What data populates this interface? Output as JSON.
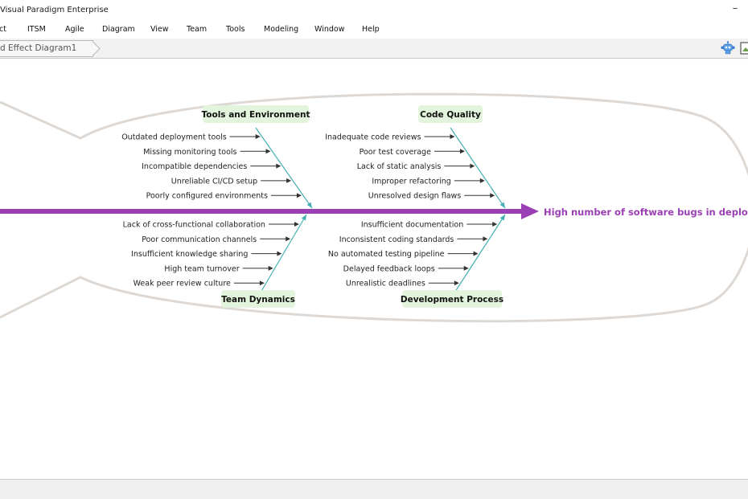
{
  "window": {
    "title": "Visual Paradigm Enterprise",
    "minimize_glyph": "–"
  },
  "menu": [
    {
      "label": "ct"
    },
    {
      "label": "ITSM"
    },
    {
      "label": "Agile"
    },
    {
      "label": "Diagram"
    },
    {
      "label": "View"
    },
    {
      "label": "Team"
    },
    {
      "label": "Tools"
    },
    {
      "label": "Modeling"
    },
    {
      "label": "Window"
    },
    {
      "label": "Help"
    }
  ],
  "tab": {
    "label": "d Effect Diagram1"
  },
  "toolbar": {
    "icons": [
      "robot-icon",
      "image-icon"
    ]
  },
  "diagram": {
    "problem": "High number of software bugs in deployme",
    "colors": {
      "spine": "#9b3fb4",
      "problem": "#9b3fb4",
      "bone": "#45b0b2",
      "category_fill": "#e2f5dc",
      "outline": "#ddd8d3",
      "cause_arrow": "#333333"
    },
    "categories": [
      {
        "name": "Tools and Environment",
        "causes": [
          "Outdated deployment tools",
          "Missing monitoring tools",
          "Incompatible dependencies",
          "Unreliable CI/CD setup",
          "Poorly configured environments"
        ]
      },
      {
        "name": "Code Quality",
        "causes": [
          "Inadequate code reviews",
          "Poor test coverage",
          "Lack of static analysis",
          "Improper refactoring",
          "Unresolved design flaws"
        ]
      },
      {
        "name": "Team Dynamics",
        "causes": [
          "Lack of cross-functional collaboration",
          "Poor communication channels",
          "Insufficient knowledge sharing",
          "High team turnover",
          "Weak peer review culture"
        ]
      },
      {
        "name": "Development Process",
        "causes": [
          "Insufficient documentation",
          "Inconsistent coding standards",
          "No automated testing pipeline",
          "Delayed feedback loops",
          "Unrealistic deadlines"
        ]
      }
    ]
  }
}
